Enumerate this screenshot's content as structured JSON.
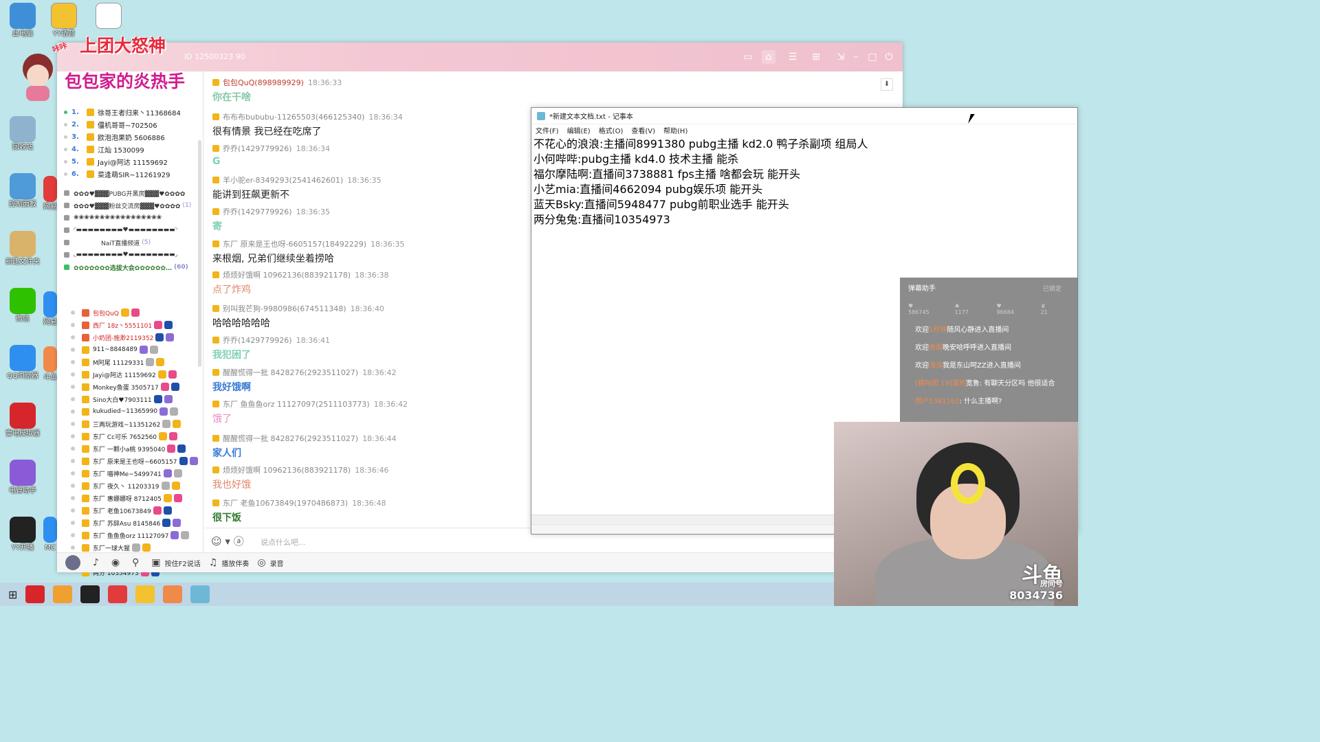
{
  "desktop_icons": [
    {
      "label": "此电脑",
      "color": "#3f8fd8"
    },
    {
      "label": "回收站",
      "color": "#8fb3cf"
    },
    {
      "label": "控制面板",
      "color": "#4f9bd9"
    },
    {
      "label": "新建文件夹",
      "color": "#d9b36a"
    },
    {
      "label": "微信",
      "color": "#2dc100"
    },
    {
      "label": "QQ浏览器",
      "color": "#2f8ff0"
    },
    {
      "label": "雷电模拟器",
      "color": "#d6262b"
    },
    {
      "label": "电管助手",
      "color": "#8a5bd6"
    },
    {
      "label": "YY开播",
      "color": "#222222"
    },
    {
      "label": "YY语音",
      "color": "#f2c230"
    },
    {
      "label": "新建文本文档",
      "color": "#ffffff"
    }
  ],
  "desktop_icon_second": [
    "网易",
    "网易",
    "斗鱼",
    "MC"
  ],
  "yy": {
    "banner_line1": "上团大怒神",
    "banner_tag": "咔咔",
    "banner_line2": "包包家的炎热手",
    "title_meta": "ID 12500323  90",
    "rank_list": [
      {
        "num": "1.",
        "name": "徐哥王者归来丶11368684"
      },
      {
        "num": "2.",
        "name": "僵机哥哥~702506"
      },
      {
        "num": "3.",
        "name": "欧泡泡果奶 5606886"
      },
      {
        "num": "4.",
        "name": "江灿 1530099"
      },
      {
        "num": "5.",
        "name": "Jayi@阿达 11159692"
      },
      {
        "num": "6.",
        "name": "菜逢萌SIR~11261929"
      }
    ],
    "channels": [
      {
        "text": "✿✿✿♥▓▓▓PUBG开黑房▓▓▓♥✿✿✿✿",
        "cnt": "",
        "hl": false
      },
      {
        "text": "✿✿✿♥▓▓▓粉丝交流房▓▓▓♥✿✿✿✿",
        "cnt": "(1)",
        "hl": false
      },
      {
        "text": "❀❀❀❀❀❀❀❀❀❀❀❀❀❀❀❀❀",
        "cnt": "",
        "hl": false
      },
      {
        "text": "◜▬▬▬▬▬▬▬▬♥▬▬▬▬▬▬▬▬◝",
        "cnt": "",
        "hl": false
      },
      {
        "text": "NaiT直播频道",
        "cnt": "(5)",
        "hl": false
      },
      {
        "text": "◟▬▬▬▬▬▬▬▬♥▬▬▬▬▬▬▬▬◞",
        "cnt": "",
        "hl": false
      },
      {
        "text": "✿✿✿✿✿✿✿选拔大会✿✿✿✿✿✿…",
        "cnt": "(60)",
        "hl": true
      }
    ],
    "users": [
      {
        "name": "包包QuQ",
        "red": true
      },
      {
        "name": "西厂 18z丶5551101",
        "red": true
      },
      {
        "name": "小奶团-施渺2119352",
        "red": true
      },
      {
        "name": "911~8848489",
        "red": false
      },
      {
        "name": "M阿尾 11129331",
        "red": false
      },
      {
        "name": "Jayi@阿达 11159692",
        "red": false
      },
      {
        "name": "Monkey鱼蛋 3505717",
        "red": false
      },
      {
        "name": "Sino大白♥7903111",
        "red": false
      },
      {
        "name": "kukudied~11365990",
        "red": false
      },
      {
        "name": "三两玩游戏~11351262",
        "red": false
      },
      {
        "name": "东厂 Cc可乐 7652560",
        "red": false
      },
      {
        "name": "东厂 一颗小a桃 9395040",
        "red": false
      },
      {
        "name": "东厂 原来是王也呀~6605157",
        "red": false
      },
      {
        "name": "东厂 喵神Me~5499741",
        "red": false
      },
      {
        "name": "东厂 夜久丶 11203319",
        "red": false
      },
      {
        "name": "东厂 惠娜娜呀 8712405",
        "red": false
      },
      {
        "name": "东厂 老鱼10673849",
        "red": false
      },
      {
        "name": "东厂 苏辞Asu 8145846",
        "red": false
      },
      {
        "name": "东厂 鱼鱼鱼orz 11127097",
        "red": false
      },
      {
        "name": "东厂一球大猩",
        "red": false
      },
      {
        "name": "丞相不好啦 11305029",
        "red": false
      },
      {
        "name": "两分 10354973",
        "red": false
      }
    ],
    "messages": [
      {
        "user": "包包QuQ(898989929)",
        "time": "18:36:33",
        "text": "你在干啥",
        "color": "#86c9a9",
        "bold": true,
        "userColor": "#c0392b"
      },
      {
        "user": "布布布bububu-11265503(466125340)",
        "time": "18:36:34",
        "text": "很有情景  我已经在吃席了",
        "color": "#222222",
        "bold": false,
        "userColor": "#888888"
      },
      {
        "user": "乔乔(1429779926)",
        "time": "18:36:34",
        "text": "G",
        "color": "#7fd1b8",
        "bold": true,
        "userColor": "#888888"
      },
      {
        "user": "羊小驼er-8349293(2541462601)",
        "time": "18:36:35",
        "text": "能讲到狂飙更新不",
        "color": "#222222",
        "bold": false,
        "userColor": "#888888"
      },
      {
        "user": "乔乔(1429779926)",
        "time": "18:36:35",
        "text": "寄",
        "color": "#7fd1b8",
        "bold": true,
        "userColor": "#888888"
      },
      {
        "user": "东厂 原来是王也呀-6605157(18492229)",
        "time": "18:36:35",
        "text": "来根烟, 兄弟们继续坐着捞哈",
        "color": "#222222",
        "bold": false,
        "userColor": "#888888"
      },
      {
        "user": "烦烦好饿啊 10962136(883921178)",
        "time": "18:36:38",
        "text": "点了炸鸡",
        "color": "#e0876a",
        "bold": false,
        "userColor": "#888888"
      },
      {
        "user": "别叫我芒狗-9980986(674511348)",
        "time": "18:36:40",
        "text": "哈哈哈哈哈哈",
        "color": "#222222",
        "bold": false,
        "userColor": "#888888"
      },
      {
        "user": "乔乔(1429779926)",
        "time": "18:36:41",
        "text": "我犯困了",
        "color": "#7fd1b8",
        "bold": true,
        "userColor": "#888888"
      },
      {
        "user": "醒醒慌得一批 8428276(2923511027)",
        "time": "18:36:42",
        "text": "我好饿啊",
        "color": "#3a7bd5",
        "bold": true,
        "userColor": "#888888"
      },
      {
        "user": "东厂 鱼鱼鱼orz 11127097(2511103773)",
        "time": "18:36:42",
        "text": "饿了",
        "color": "#e88bc7",
        "bold": false,
        "userColor": "#888888"
      },
      {
        "user": "醒醒慌得一批 8428276(2923511027)",
        "time": "18:36:44",
        "text": "家人们",
        "color": "#3a7bd5",
        "bold": true,
        "userColor": "#888888"
      },
      {
        "user": "烦烦好饿啊 10962136(883921178)",
        "time": "18:36:46",
        "text": "我也好饿",
        "color": "#e0876a",
        "bold": false,
        "userColor": "#888888"
      },
      {
        "user": "东厂 老鱼10673849(1970486873)",
        "time": "18:36:48",
        "text": "很下饭",
        "color": "#2f7a2f",
        "bold": true,
        "userColor": "#888888"
      }
    ],
    "input_placeholder": "说点什么吧...",
    "bottom_tools": [
      {
        "icon": "♪",
        "label": ""
      },
      {
        "icon": "◉",
        "label": ""
      },
      {
        "icon": "⚲",
        "label": ""
      },
      {
        "icon": "▣",
        "label": "按住F2说话"
      },
      {
        "icon": "♫",
        "label": "播放伴奏"
      },
      {
        "icon": "◎",
        "label": "录音"
      }
    ],
    "template_label": "频道模板"
  },
  "notepad": {
    "title": "*新建文本文档.txt - 记事本",
    "menu": [
      "文件(F)",
      "编辑(E)",
      "格式(O)",
      "查看(V)",
      "帮助(H)"
    ],
    "lines": [
      "不花心的浪浪:主播间8991380 pubg主播 kd2.0 鸭子杀副项 组局人",
      "小何哔哔:pubg主播 kd4.0 技术主播  能杀",
      "福尔摩陆啊:直播间3738881 fps主播 啥都会玩  能开头",
      "小艺mia:直播间4662094 pubg娱乐项  能开头",
      "蓝天Bsky:直播间5948477 pubg前职业选手 能开头",
      "两分兔兔:直播间10354973"
    ]
  },
  "danmu": {
    "title": "弹幕助手",
    "locked": "已锁定",
    "stats": [
      "586745",
      "1177",
      "96684",
      "21"
    ],
    "lines": [
      {
        "pre": "欢迎",
        "name": "1秒钟",
        "post": "随风心静进入直播间"
      },
      {
        "pre": "欢迎",
        "name": "浙阁",
        "post": "晚安哈呼呼进入直播间"
      },
      {
        "pre": "欢迎",
        "name": "浅浅",
        "post": "我是东山呵ZZ进入直播间"
      },
      {
        "pre": "[猪叫团 19]",
        "name": "温热",
        "post": "宽鲁:  有聊天分区吗  他很适合"
      },
      {
        "pre": "",
        "name": "用户1381162",
        "post": ":  什么主播啊?"
      }
    ]
  },
  "cam": {
    "logo": "斗鱼",
    "room_label": "房间号",
    "room": "8034736"
  },
  "taskbar_colors": [
    "#d6262b",
    "#f0a030",
    "#222222",
    "#e23b3b",
    "#f2c230",
    "#f08a4b",
    "#6eb8d6"
  ]
}
